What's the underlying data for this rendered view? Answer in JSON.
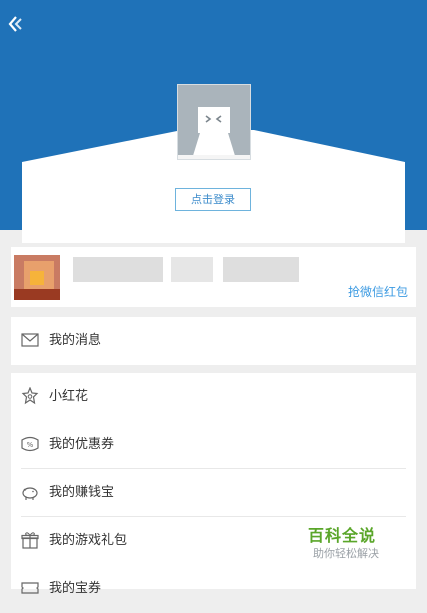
{
  "profile": {
    "login_label": "点击登录"
  },
  "promo": {
    "action_label": "抢微信红包"
  },
  "menu": {
    "messages_label": "我的消息",
    "items": [
      {
        "label": "小红花",
        "icon": "flower-icon"
      },
      {
        "label": "我的优惠券",
        "icon": "coupon-icon"
      },
      {
        "label": "我的赚钱宝",
        "icon": "piggy-bank-icon"
      },
      {
        "label": "我的游戏礼包",
        "icon": "gift-icon"
      },
      {
        "label": "我的宝券",
        "icon": "ticket-icon"
      }
    ]
  },
  "watermark": {
    "title": "百科全说",
    "subtitle": "助你轻松解决"
  },
  "colors": {
    "header": "#1f72b8",
    "accent": "#3d9be2",
    "watermark": "#5aa62a"
  }
}
